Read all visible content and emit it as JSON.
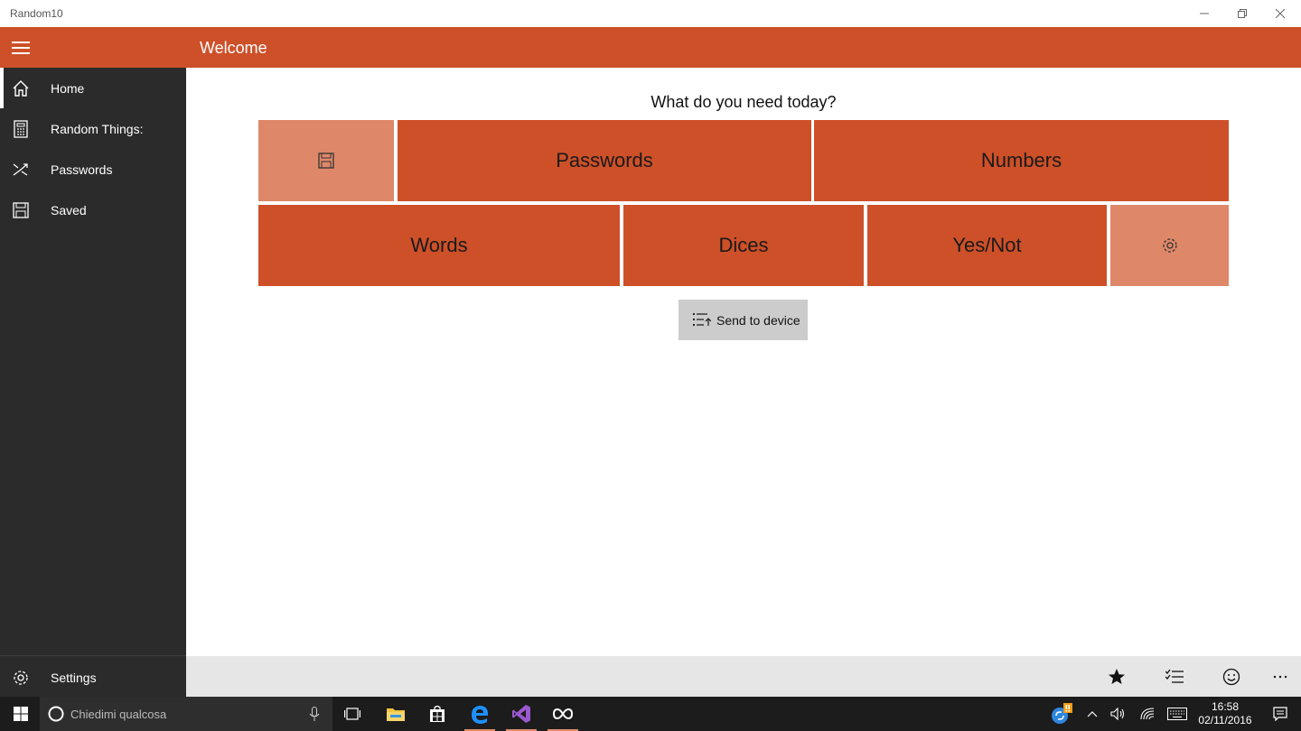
{
  "window": {
    "title": "Random10"
  },
  "header": {
    "title": "Welcome"
  },
  "sidebar": {
    "items": [
      {
        "label": "Home"
      },
      {
        "label": "Random Things:"
      },
      {
        "label": "Passwords"
      },
      {
        "label": "Saved"
      }
    ],
    "settings_label": "Settings"
  },
  "main": {
    "question": "What do you need today?",
    "tiles": {
      "passwords": "Passwords",
      "numbers": "Numbers",
      "words": "Words",
      "dices": "Dices",
      "yesnot": "Yes/Not"
    },
    "send_button": "Send to device"
  },
  "taskbar": {
    "search_placeholder": "Chiedimi qualcosa",
    "time": "16:58",
    "date": "02/11/2016"
  },
  "colors": {
    "accent": "#CD5029",
    "accent_light": "#DE8869",
    "sidebar": "#2B2B2B"
  }
}
